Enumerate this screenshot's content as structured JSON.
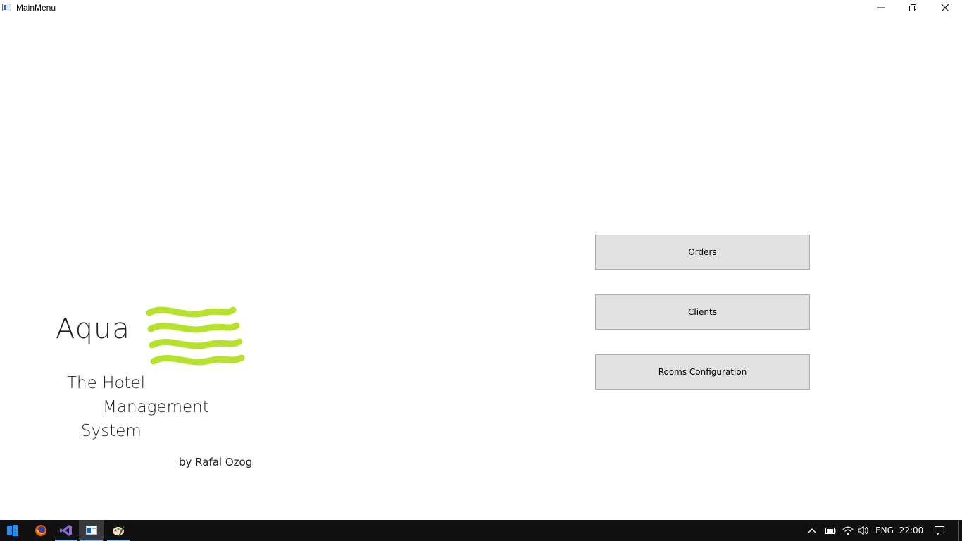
{
  "window": {
    "title": "MainMenu"
  },
  "logo": {
    "name": "Aqua",
    "tagline": [
      "The Hotel",
      "Management",
      "System"
    ],
    "author": "by Rafal Ozog",
    "wave_color": "#b6e22e"
  },
  "menu": {
    "orders_label": "Orders",
    "clients_label": "Clients",
    "rooms_label": "Rooms Configuration"
  },
  "taskbar": {
    "language": "ENG",
    "time": "22:00",
    "apps": [
      "firefox-icon",
      "visual-studio-icon",
      "mainmenu-app-icon",
      "paint-icon"
    ]
  }
}
